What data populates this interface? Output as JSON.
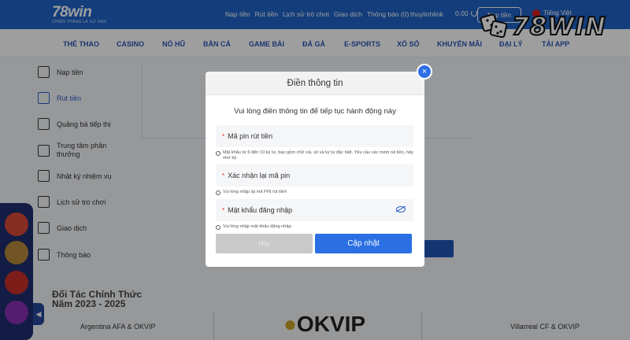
{
  "header": {
    "logo": "78win",
    "logo_tagline": "CHIẾN THẮNG LÀ XỨ HẠN",
    "links": [
      "Nạp tiền",
      "Rút tiền",
      "Lịch sử trò chơi",
      "Giao dịch",
      "Thông báo (0)"
    ],
    "username": "thuylinhlink",
    "balance": "0.00",
    "deposit_label": "Nạp tiền",
    "language": "Tiếng Việt"
  },
  "nav": {
    "items": [
      "THỂ THAO",
      "CASINO",
      "NỔ HŨ",
      "BẮN CÁ",
      "GAME BÀI",
      "ĐÁ GÀ",
      "E-SPORTS",
      "XỔ SỐ",
      "KHUYẾN MÃI",
      "ĐẠI LÝ",
      "TẢI APP"
    ]
  },
  "brand": {
    "text": "78WIN"
  },
  "sidebar": {
    "items": [
      {
        "label": "Nạp tiền",
        "icon": "deposit-icon"
      },
      {
        "label": "Rút tiền",
        "icon": "withdraw-icon"
      },
      {
        "label": "Quảng bá tiếp thị",
        "icon": "promotion-icon"
      },
      {
        "label": "Trung tâm phần thưởng",
        "icon": "reward-icon"
      },
      {
        "label": "Nhật ký nhiệm vụ",
        "icon": "task-log-icon"
      },
      {
        "label": "Lịch sử trò chơi",
        "icon": "history-icon"
      },
      {
        "label": "Giao dịch",
        "icon": "transaction-icon"
      },
      {
        "label": "Thông báo",
        "icon": "mail-icon"
      }
    ]
  },
  "partners": {
    "title": "Đối Tác Chính Thức Năm 2023 - 2025",
    "items": [
      "Argentina AFA & OKVIP",
      "OKVIP",
      "Villarreal CF & OKVIP"
    ]
  },
  "modal": {
    "title": "Điền thông tin",
    "description": "Vui lòng điền thông tin để tiếp tục hành động này",
    "fields": [
      {
        "required": "*",
        "placeholder": "Mã pin rút tiền",
        "hint": "Mật khẩu từ 6 đến 10 ký tự, bao gồm chữ cái, số và ký tự đặc biệt. Yêu cầu xác minh rút tiền, hãy nhớ kỹ."
      },
      {
        "required": "*",
        "placeholder": "Xác nhận lại mã pin",
        "hint": "Vui lòng nhập lại mã PIN rút tiền!"
      },
      {
        "required": "*",
        "placeholder": "Mật khẩu đăng nhập",
        "hint": "Vui lòng nhập mật khẩu đăng nhập."
      }
    ],
    "cancel_label": "Hủy",
    "submit_label": "Cập nhật",
    "close_label": "×"
  }
}
